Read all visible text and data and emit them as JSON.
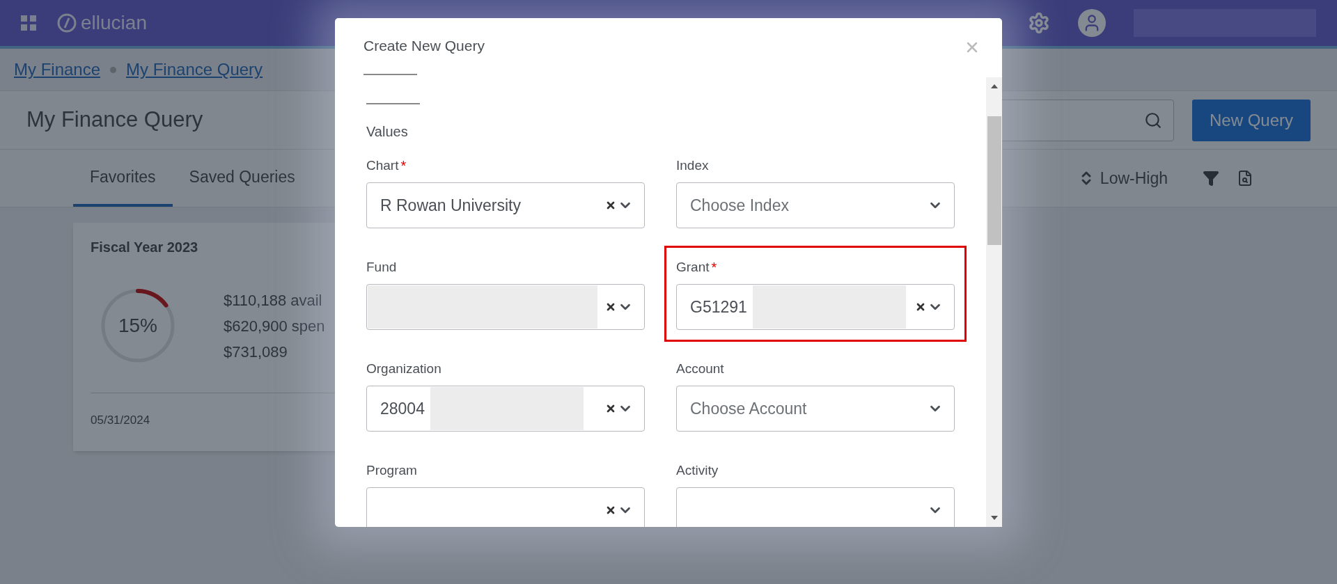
{
  "header": {
    "logo": "ellucian"
  },
  "breadcrumbs": [
    {
      "label": "My Finance"
    },
    {
      "label": "My Finance Query"
    }
  ],
  "page_title": "My Finance Query",
  "new_query_button": "New Query",
  "tabs": [
    {
      "label": "Favorites",
      "selected": true
    },
    {
      "label": "Saved Queries",
      "selected": false
    }
  ],
  "sort": {
    "label": "Low-High"
  },
  "card": {
    "title": "Fiscal Year 2023",
    "percent": "15%",
    "level": 0.15,
    "lines": [
      "$110,188 avail",
      "$620,900 spen",
      "$731,089"
    ],
    "date": "05/31/2024"
  },
  "modal": {
    "title": "Create New Query",
    "section": "Values",
    "fields": [
      {
        "label": "Chart",
        "required_mark": "*",
        "value": "R Rowan University",
        "clearable": true,
        "redacted": false,
        "highlighted": false
      },
      {
        "label": "Index",
        "placeholder": "Choose Index",
        "clearable": false,
        "redacted": false,
        "highlighted": false
      },
      {
        "label": "Fund",
        "clearable": true,
        "redacted": true,
        "highlighted": false
      },
      {
        "label": "Grant",
        "required_mark": "*",
        "value": "G51291",
        "clearable": true,
        "redacted": true,
        "highlighted": true
      },
      {
        "label": "Organization",
        "value": "28004",
        "clearable": true,
        "redacted": true,
        "highlighted": false
      },
      {
        "label": "Account",
        "placeholder": "Choose Account",
        "clearable": false,
        "redacted": false,
        "highlighted": false
      },
      {
        "label": "Program",
        "clearable": true,
        "redacted": false,
        "highlighted": false
      },
      {
        "label": "Activity",
        "clearable": false,
        "redacted": false,
        "highlighted": false
      }
    ]
  }
}
